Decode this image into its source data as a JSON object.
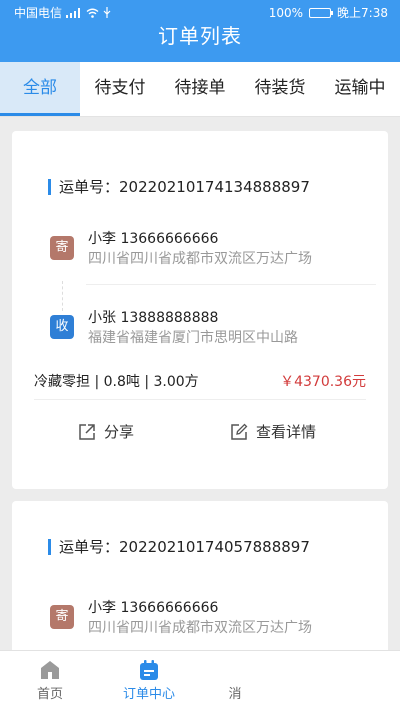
{
  "status_bar": {
    "carrier": "中国电信",
    "battery": "100%",
    "battery_level": 1.0,
    "time": "晚上7:38"
  },
  "header": {
    "title": "订单列表"
  },
  "tabs": [
    {
      "label": "全部"
    },
    {
      "label": "待支付"
    },
    {
      "label": "待接单"
    },
    {
      "label": "待装货"
    },
    {
      "label": "运输中"
    }
  ],
  "orders": [
    {
      "waybill_label": "运单号：",
      "waybill_no": "20220210174134888897",
      "sender": {
        "tag": "寄",
        "name": "小李  13666666666",
        "address": "四川省四川省成都市双流区万达广场"
      },
      "receiver": {
        "tag": "收",
        "name": "小张  13888888888",
        "address": "福建省福建省厦门市思明区中山路"
      },
      "cargo": "冷藏零担 | 0.8吨 | 3.00方",
      "price": "￥4370.36元",
      "share_label": "分享",
      "detail_label": "查看详情"
    },
    {
      "waybill_label": "运单号：",
      "waybill_no": "20220210174057888897",
      "sender": {
        "tag": "寄",
        "name": "小李  13666666666",
        "address": "四川省四川省成都市双流区万达广场"
      }
    }
  ],
  "bottom_nav": [
    {
      "label": "首页"
    },
    {
      "label": "订单中心"
    },
    {
      "label": "消"
    }
  ],
  "colors": {
    "primary": "#3d9af0",
    "accent": "#2b8be8",
    "price": "#d23b3b",
    "sender_badge": "#b4786a",
    "receiver_badge": "#2f7fd6"
  }
}
